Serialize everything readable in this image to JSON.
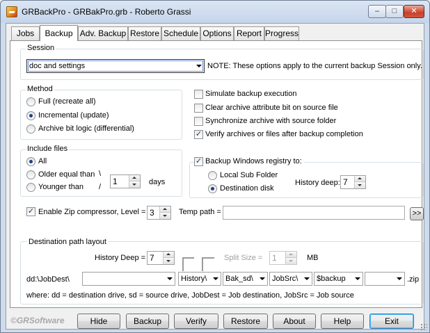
{
  "window": {
    "title": "GRBackPro - GRBakPro.grb - Roberto Grassi",
    "minimize_glyph": "–",
    "maximize_glyph": "□",
    "close_glyph": "✕"
  },
  "tabs": [
    {
      "label": "Jobs"
    },
    {
      "label": "Backup"
    },
    {
      "label": "Adv. Backup"
    },
    {
      "label": "Restore"
    },
    {
      "label": "Schedule"
    },
    {
      "label": "Options"
    },
    {
      "label": "Report"
    },
    {
      "label": "Progress"
    }
  ],
  "session": {
    "group_label": "Session",
    "selected": "doc and settings",
    "note": "NOTE: These options apply to the current backup Session only."
  },
  "method": {
    "group_label": "Method",
    "options": [
      {
        "label": "Full (recreate all)",
        "checked": false
      },
      {
        "label": "Incremental (update)",
        "checked": true
      },
      {
        "label": "Archive bit logic (differential)",
        "checked": false
      }
    ]
  },
  "checks": [
    {
      "label": "Simulate backup execution",
      "checked": false
    },
    {
      "label": "Clear archive attribute bit on source file",
      "checked": false
    },
    {
      "label": "Synchronize archive with source folder",
      "checked": false
    },
    {
      "label": "Verify archives or files after backup completion",
      "checked": true
    }
  ],
  "include_files": {
    "group_label": "Include files",
    "all": "All",
    "older": "Older equal than",
    "younger": "Younger than",
    "slash_top": "\\",
    "slash_bottom": "/",
    "days_value": "1",
    "days_label": "days"
  },
  "registry": {
    "label": "Backup Windows registry to:",
    "checked": true,
    "local": "Local Sub Folder",
    "destination": "Destination disk",
    "history_label": "History deep:",
    "history_value": "7"
  },
  "zip": {
    "label": "Enable Zip compressor, Level =",
    "checked": true,
    "level": "3",
    "temp_label": "Temp path =",
    "temp_value": "",
    "browse_label": ">>"
  },
  "destination": {
    "group_label": "Destination path layout",
    "history_label": "History Deep =",
    "history_value": "7",
    "split_label": "Split Size =",
    "split_value": "1",
    "split_unit": "MB",
    "prefix": "dd:\\JobDest\\",
    "segments": [
      "",
      "History\\",
      "Bak_sd\\",
      "JobSrc\\",
      "$backup",
      ""
    ],
    "suffix": ".zip",
    "legend": "where: dd = destination drive, sd = source drive, JobDest = Job destination, JobSrc = Job source"
  },
  "footer": {
    "logo": "©GRSoftware",
    "buttons": [
      "Hide",
      "Backup",
      "Verify",
      "Restore",
      "About",
      "Help",
      "Exit"
    ]
  }
}
